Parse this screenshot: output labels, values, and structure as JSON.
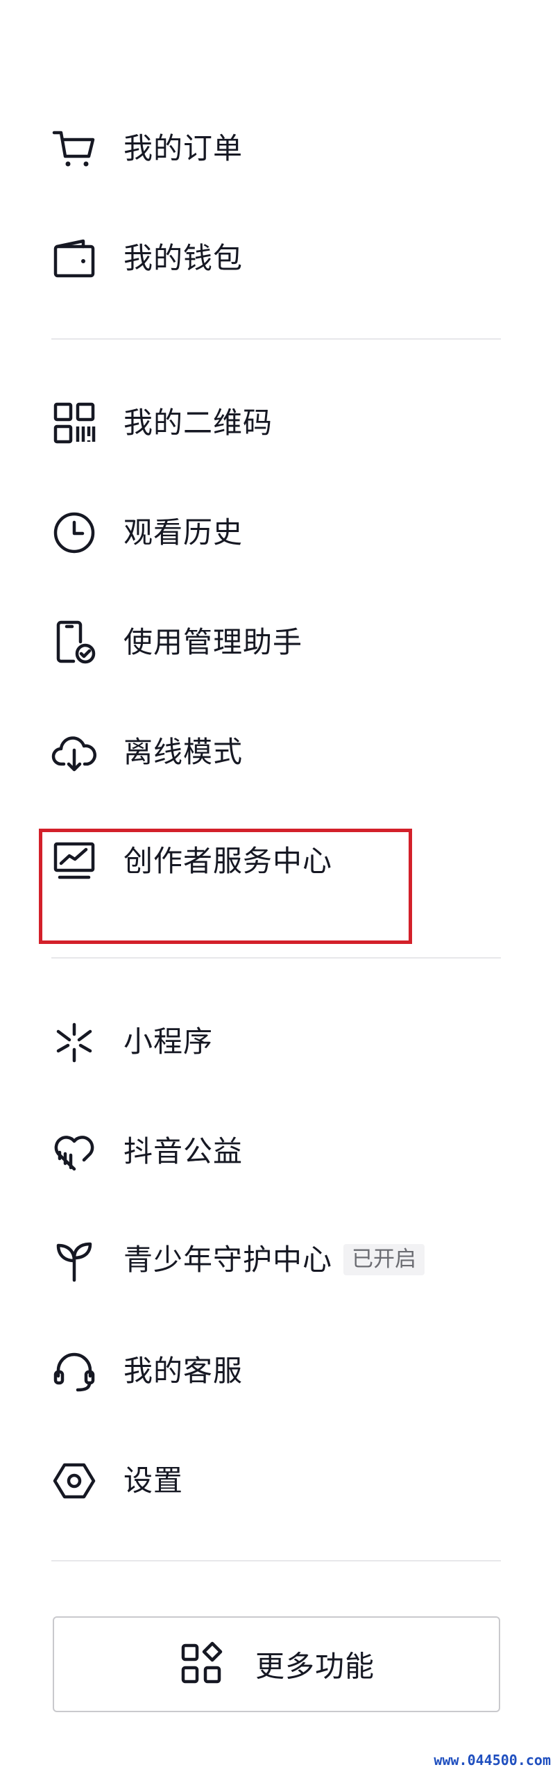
{
  "menu": {
    "group1": [
      {
        "label": "我的订单",
        "icon": "cart-icon"
      },
      {
        "label": "我的钱包",
        "icon": "wallet-icon"
      }
    ],
    "group2": [
      {
        "label": "我的二维码",
        "icon": "qrcode-icon"
      },
      {
        "label": "观看历史",
        "icon": "clock-icon"
      },
      {
        "label": "使用管理助手",
        "icon": "phone-check-icon"
      },
      {
        "label": "离线模式",
        "icon": "cloud-download-icon"
      },
      {
        "label": "创作者服务中心",
        "icon": "chart-monitor-icon"
      }
    ],
    "group3": [
      {
        "label": "小程序",
        "icon": "mini-program-icon"
      },
      {
        "label": "抖音公益",
        "icon": "heart-charity-icon"
      },
      {
        "label": "青少年守护中心",
        "icon": "sprout-icon",
        "badge": "已开启"
      },
      {
        "label": "我的客服",
        "icon": "headset-icon"
      },
      {
        "label": "设置",
        "icon": "hexagon-settings-icon"
      }
    ]
  },
  "more_button": {
    "label": "更多功能",
    "icon": "grid-shapes-icon"
  },
  "highlight_color": "#d3202a",
  "watermark": "www.044500.com"
}
